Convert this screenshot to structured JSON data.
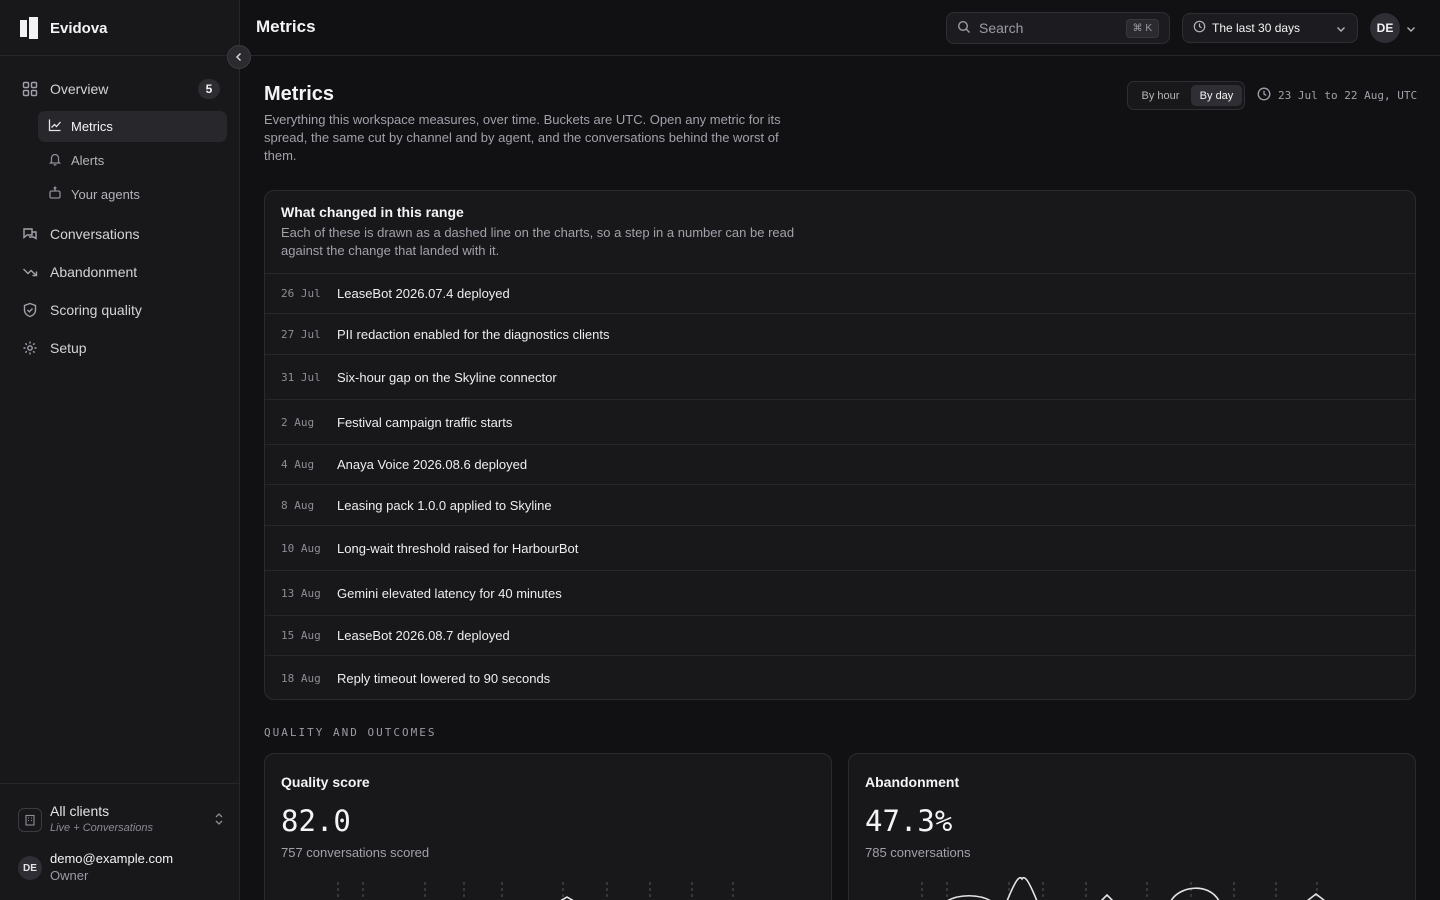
{
  "brand": {
    "name": "Evidova"
  },
  "nav": {
    "overview": {
      "label": "Overview",
      "badge": "5"
    },
    "sub": [
      {
        "label": "Metrics"
      },
      {
        "label": "Alerts"
      },
      {
        "label": "Your agents"
      }
    ],
    "conversations": "Conversations",
    "abandonment": "Abandonment",
    "scoring": "Scoring quality",
    "setup": "Setup"
  },
  "client_selector": {
    "title": "All clients",
    "subtitle": "Live + Conversations"
  },
  "user": {
    "email": "demo@example.com",
    "role": "Owner",
    "initials": "DE"
  },
  "topbar": {
    "title": "Metrics",
    "search_placeholder": "Search",
    "search_shortcut": "⌘ K",
    "range": "The last 30 days",
    "avatar_initials": "DE"
  },
  "page": {
    "title": "Metrics",
    "description": "Everything this workspace measures, over time. Buckets are UTC. Open any metric for its spread, the same cut by channel and by agent, and the conversations behind the worst of them.",
    "bucket_options": [
      "By hour",
      "By day"
    ],
    "bucket_selected": "By day",
    "range_readout": "23 Jul to 22 Aug, UTC"
  },
  "changes": {
    "title": "What changed in this range",
    "description": "Each of these is drawn as a dashed line on the charts, so a step in a number can be read against the change that landed with it.",
    "items": [
      {
        "date": "26 Jul",
        "label": "LeaseBot 2026.07.4 deployed"
      },
      {
        "date": "27 Jul",
        "label": "PII redaction enabled for the diagnostics clients"
      },
      {
        "date": "31 Jul",
        "label": "Six-hour gap on the Skyline connector"
      },
      {
        "date": "2 Aug",
        "label": "Festival campaign traffic starts"
      },
      {
        "date": "4 Aug",
        "label": "Anaya Voice 2026.08.6 deployed"
      },
      {
        "date": "8 Aug",
        "label": "Leasing pack 1.0.0 applied to Skyline"
      },
      {
        "date": "10 Aug",
        "label": "Long-wait threshold raised for HarbourBot"
      },
      {
        "date": "13 Aug",
        "label": "Gemini elevated latency for 40 minutes"
      },
      {
        "date": "15 Aug",
        "label": "LeaseBot 2026.08.7 deployed"
      },
      {
        "date": "18 Aug",
        "label": "Reply timeout lowered to 90 seconds"
      }
    ]
  },
  "section_label": "QUALITY AND OUTCOMES",
  "metrics": [
    {
      "title": "Quality score",
      "value": "82.0",
      "subtitle": "757 conversations scored"
    },
    {
      "title": "Abandonment",
      "value": "47.3%",
      "subtitle": "785 conversations"
    }
  ],
  "colors": {
    "background": "#111114",
    "panel": "#18181b",
    "accent": "#f4f4f5"
  }
}
